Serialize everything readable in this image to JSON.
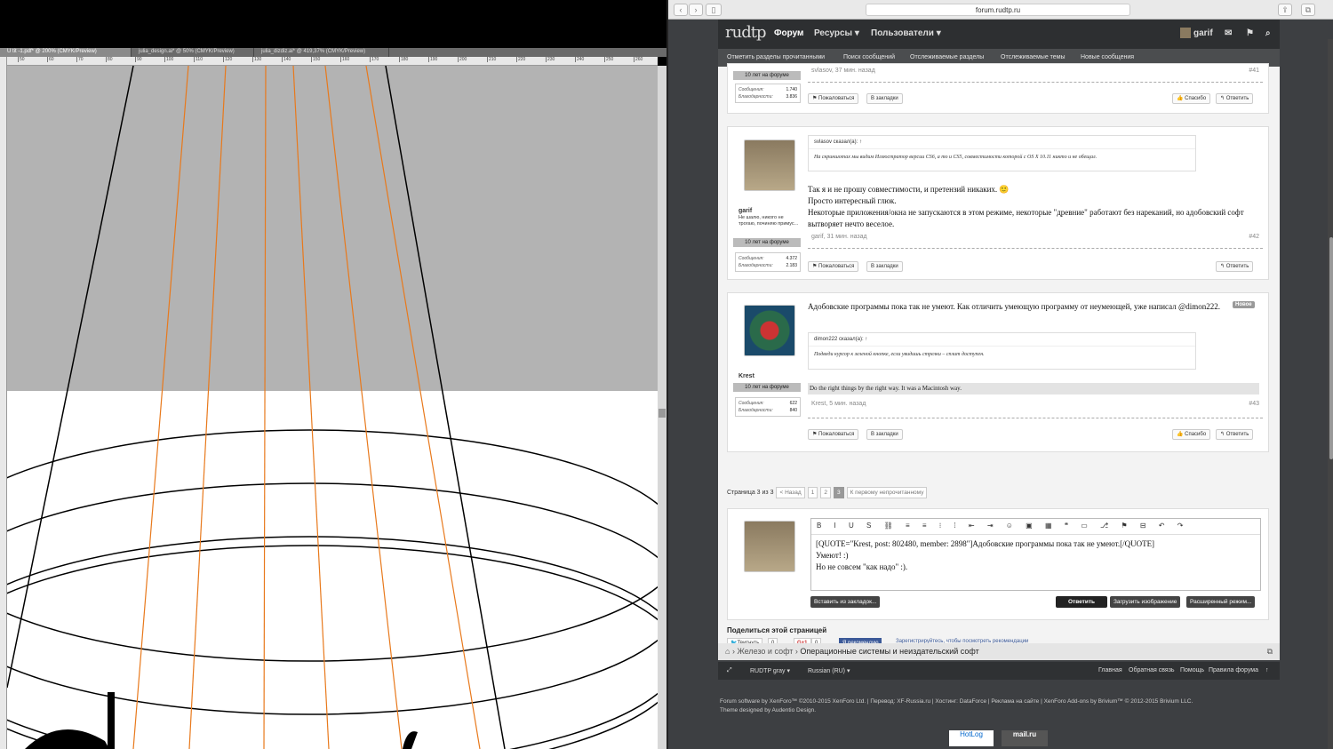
{
  "illustrator": {
    "tabs": [
      "U   tit   -1.pdf* @ 200% (CMYK/Preview)",
      "julia_design.ai* @ 50% (CMYK/Preview)",
      "julia_dizdiz.ai* @ 419,37% (CMYK/Preview)"
    ],
    "ruler_marks": [
      "50",
      "60",
      "70",
      "80",
      "90",
      "100",
      "110",
      "120",
      "130",
      "140",
      "150",
      "160",
      "170",
      "180",
      "190",
      "200",
      "210",
      "220",
      "230",
      "240",
      "250",
      "260"
    ]
  },
  "browser": {
    "url": "forum.rudtp.ru",
    "logo": "rudtp",
    "nav": {
      "forum": "Форум",
      "resources": "Ресурсы ▾",
      "users": "Пользователи ▾",
      "username": "garif"
    },
    "subnav": [
      "Отметить разделы прочитанными",
      "Поиск сообщений",
      "Отслеживаемые разделы",
      "Отслеживаемые темы",
      "Новые сообщения"
    ]
  },
  "posts": [
    {
      "badge": "10 лет на форуме",
      "stat_msgs_label": "Сообщения:",
      "stat_msgs": "1.740",
      "stat_likes_label": "Благодарности:",
      "stat_likes": "3.836",
      "meta": "svlasov, 37 мин. назад",
      "num": "#41",
      "report": "Пожаловаться",
      "bookmark": "В закладки",
      "thanks": "Спасибо",
      "reply": "Ответить"
    },
    {
      "username": "garif",
      "usertitle": "Не шалю, никого не трогаю, починяю примус...",
      "badge": "10 лет на форуме",
      "stat_msgs_label": "Сообщения:",
      "stat_msgs": "4.372",
      "stat_likes_label": "Благодарности:",
      "stat_likes": "2.183",
      "quote_head": "svlasov сказал(а): ↑",
      "quote_body": "На скриншотах мы видим Иллюстратор версии CS6, а то и CS5, совместимости которой с OS X 10.11 никто и не обещал.",
      "line1": "Так я и не прошу совместимости, и претензий никаких. 🙂",
      "line2": "Просто интересный глюк.",
      "line3": "Некоторые приложения/окна не запускаются в этом режиме, некоторые \"древние\" работают без нареканий, но адобовский софт вытворяет нечто веселое.",
      "meta": "garif, 31 мин. назад",
      "num": "#42",
      "report": "Пожаловаться",
      "bookmark": "В закладки",
      "reply": "Ответить"
    },
    {
      "username": "Krest",
      "badge": "10 лет на форуме",
      "stat_msgs_label": "Сообщения:",
      "stat_msgs": "622",
      "stat_likes_label": "Благодарности:",
      "stat_likes": "840",
      "new_badge": "Новое",
      "text": "Адобовские программы пока так не умеют. Как отличить умеющую программу от неумеющей, уже написал @dimon222.",
      "quote_head": "dimon222 сказал(а): ↑",
      "quote_body": "Подведи курсор к зеленой кнопке, если увидишь стрелки – сплит доступен.",
      "signature": "Do the right things by the right way. It was a Macintosh way.",
      "meta": "Krest, 5 мин. назад",
      "num": "#43",
      "report": "Пожаловаться",
      "bookmark": "В закладки",
      "thanks": "Спасибо",
      "reply": "Ответить"
    }
  ],
  "pager": {
    "label": "Страница 3 из 3",
    "prev": "< Назад",
    "p1": "1",
    "p2": "2",
    "p3": "3",
    "unread": "К первому непрочитанному"
  },
  "reply_box": {
    "tools": "B I U S ⛓ ≡ ≡ ⁝ ⁞ ⇤ ⇥ ☺ ▣ ▦ ❝ ▭ ⎇ ⚑ ⊟ ↶ ↷",
    "line1": "[QUOTE=\"Krest, post: 802480, member: 2898\"]Адобовские программы пока так не умеют.[/QUOTE]",
    "line2": "Умеют! :)",
    "line3": "Но не совсем \"как надо\" :).",
    "insert": "Вставить из закладок...",
    "submit": "Ответить",
    "upload": "Загрузить изображение",
    "advanced": "Расширенный режим..."
  },
  "share": {
    "title": "Поделиться этой страницей",
    "tweet": "Твитнуть",
    "tweet_count": "0",
    "gplus": "G+1",
    "gplus_count": "0",
    "fb": "Я рекомендую",
    "fb_text": "Зарегистрируйтесь, чтобы посмотреть рекомендации друзей"
  },
  "breadcrumb": {
    "part1": "Железо и софт",
    "part2": "Операционные системы и неиздательский софт"
  },
  "footer": {
    "style": "RUDTP gray ▾",
    "lang": "Russian (RU) ▾",
    "home": "Главная",
    "feedback": "Обратная связь",
    "help": "Помощь",
    "rules": "Правила форума"
  },
  "copyright": {
    "line1": "Forum software by XenForo™ ©2010-2015 XenForo Ltd. | Перевод: XF-Russia.ru | Хостинг: DataForce | Реклама на сайте | XenForo Add-ons by Brivium™ © 2012-2015 Brivium LLC.",
    "line2": "Theme designed by Audentio Design."
  },
  "counters": {
    "c1": "HotLog",
    "c2": "mail.ru"
  }
}
